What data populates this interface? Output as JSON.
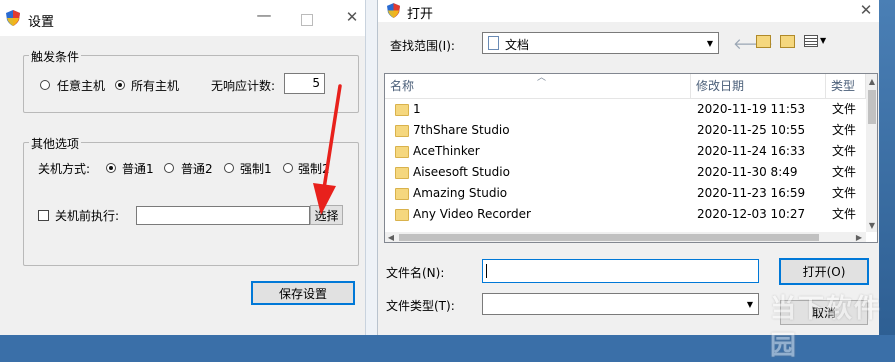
{
  "settings": {
    "title": "设置",
    "trigger_group": "触发条件",
    "radio_any_host": "任意主机",
    "radio_all_hosts": "所有主机",
    "no_response_label": "无响应计数:",
    "no_response_value": "5",
    "other_group": "其他选项",
    "shutdown_mode_label": "关机方式:",
    "mode_normal1": "普通1",
    "mode_normal2": "普通2",
    "mode_force1": "强制1",
    "mode_force2": "强制2",
    "pre_shutdown_label": "关机前执行:",
    "pre_shutdown_value": "",
    "select_button": "选择",
    "save_button": "保存设置"
  },
  "open_dialog": {
    "title": "打开",
    "look_in_label": "查找范围(I):",
    "look_in_value": "文档",
    "columns": {
      "name": "名称",
      "modified": "修改日期",
      "type": "类型"
    },
    "rows": [
      {
        "name": "1",
        "modified": "2020-11-19 11:53",
        "type": "文件"
      },
      {
        "name": "7thShare Studio",
        "modified": "2020-11-25 10:55",
        "type": "文件"
      },
      {
        "name": "AceThinker",
        "modified": "2020-11-24 16:33",
        "type": "文件"
      },
      {
        "name": "Aiseesoft Studio",
        "modified": "2020-11-30 8:49",
        "type": "文件"
      },
      {
        "name": "Amazing Studio",
        "modified": "2020-11-23 16:59",
        "type": "文件"
      },
      {
        "name": "Any Video Recorder",
        "modified": "2020-12-03 10:27",
        "type": "文件"
      }
    ],
    "filename_label": "文件名(N):",
    "filename_value": "",
    "filetype_label": "文件类型(T):",
    "filetype_value": "",
    "open_button": "打开(O)",
    "cancel_button": "取消"
  },
  "watermark": "当下软件园"
}
